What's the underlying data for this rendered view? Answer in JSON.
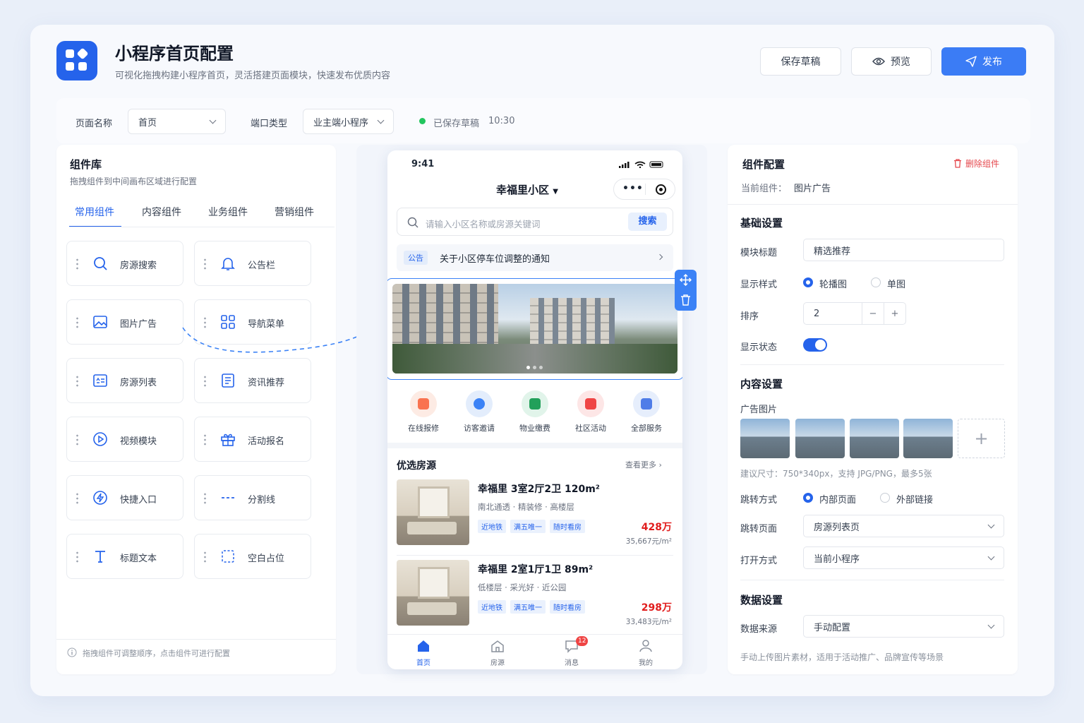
{
  "header": {
    "title": "小程序首页配置",
    "subtitle": "可视化拖拽构建小程序首页，灵活搭建页面模块，快速发布优质内容",
    "save_draft": "保存草稿",
    "preview": "预览",
    "publish": "发布"
  },
  "toolbar": {
    "page_name_label": "页面名称",
    "page_name_value": "首页",
    "port_type_label": "端口类型",
    "port_type_value": "业主端小程序",
    "save_status": "已保存草稿",
    "save_time": "10:30"
  },
  "library": {
    "title": "组件库",
    "desc": "拖拽组件到中间画布区域进行配置",
    "tabs": [
      "常用组件",
      "内容组件",
      "业务组件",
      "营销组件"
    ],
    "items": [
      {
        "label": "房源搜索",
        "icon": "search-icon"
      },
      {
        "label": "公告栏",
        "icon": "bell-icon"
      },
      {
        "label": "图片广告",
        "icon": "image-icon"
      },
      {
        "label": "导航菜单",
        "icon": "grid-icon"
      },
      {
        "label": "房源列表",
        "icon": "list-icon"
      },
      {
        "label": "资讯推荐",
        "icon": "article-icon"
      },
      {
        "label": "视频模块",
        "icon": "play-icon"
      },
      {
        "label": "活动报名",
        "icon": "gift-icon"
      },
      {
        "label": "快捷入口",
        "icon": "lightning-icon"
      },
      {
        "label": "分割线",
        "icon": "divider-icon"
      },
      {
        "label": "标题文本",
        "icon": "text-icon"
      },
      {
        "label": "空白占位",
        "icon": "blank-icon"
      }
    ],
    "tip": "拖拽组件可调整顺序，点击组件可进行配置"
  },
  "phone": {
    "time": "9:41",
    "community": "幸福里小区",
    "search_placeholder": "请输入小区名称或房源关键词",
    "search_btn": "搜索",
    "notice_tag": "公告",
    "notice_text": "关于小区停车位调整的通知",
    "quick": [
      "在线报修",
      "访客邀请",
      "物业缴费",
      "社区活动",
      "全部服务"
    ],
    "section_title": "优选房源",
    "more": "查看更多",
    "listings": [
      {
        "title": "幸福里 3室2厅2卫 120m²",
        "desc": "南北通透 · 精装修 · 高楼层",
        "tags": [
          "近地铁",
          "满五唯一",
          "随时看房"
        ],
        "price": "428万",
        "unit": "35,667元/m²"
      },
      {
        "title": "幸福里 2室1厅1卫 89m²",
        "desc": "低楼层 · 采光好 · 近公园",
        "tags": [
          "近地铁",
          "满五唯一",
          "随时看房"
        ],
        "price": "298万",
        "unit": "33,483元/m²"
      }
    ],
    "nav": [
      "首页",
      "房源",
      "消息",
      "我的"
    ],
    "badge": "12"
  },
  "config": {
    "title": "组件配置",
    "delete": "删除组件",
    "current_label": "当前组件：",
    "current_value": "图片广告",
    "basic": "基础设置",
    "module_title_label": "模块标题",
    "module_title_value": "精选推荐",
    "style_label": "显示样式",
    "style_opts": [
      "轮播图",
      "单图"
    ],
    "order_label": "排序",
    "order_value": "2",
    "status_label": "显示状态",
    "content": "内容设置",
    "ad_label": "广告图片",
    "hint": "建议尺寸：750*340px，支持 JPG/PNG，最多5张",
    "jump_label": "跳转方式",
    "jump_opts": [
      "内部页面",
      "外部链接"
    ],
    "page_label": "跳转页面",
    "page_value": "房源列表页",
    "open_label": "打开方式",
    "open_value": "当前小程序",
    "data": "数据设置",
    "source_label": "数据来源",
    "source_value": "手动配置",
    "data_hint": "手动上传图片素材，适用于活动推广、品牌宣传等场景"
  },
  "colors": {
    "accent": "#2563eb",
    "price": "#e11d1d"
  }
}
